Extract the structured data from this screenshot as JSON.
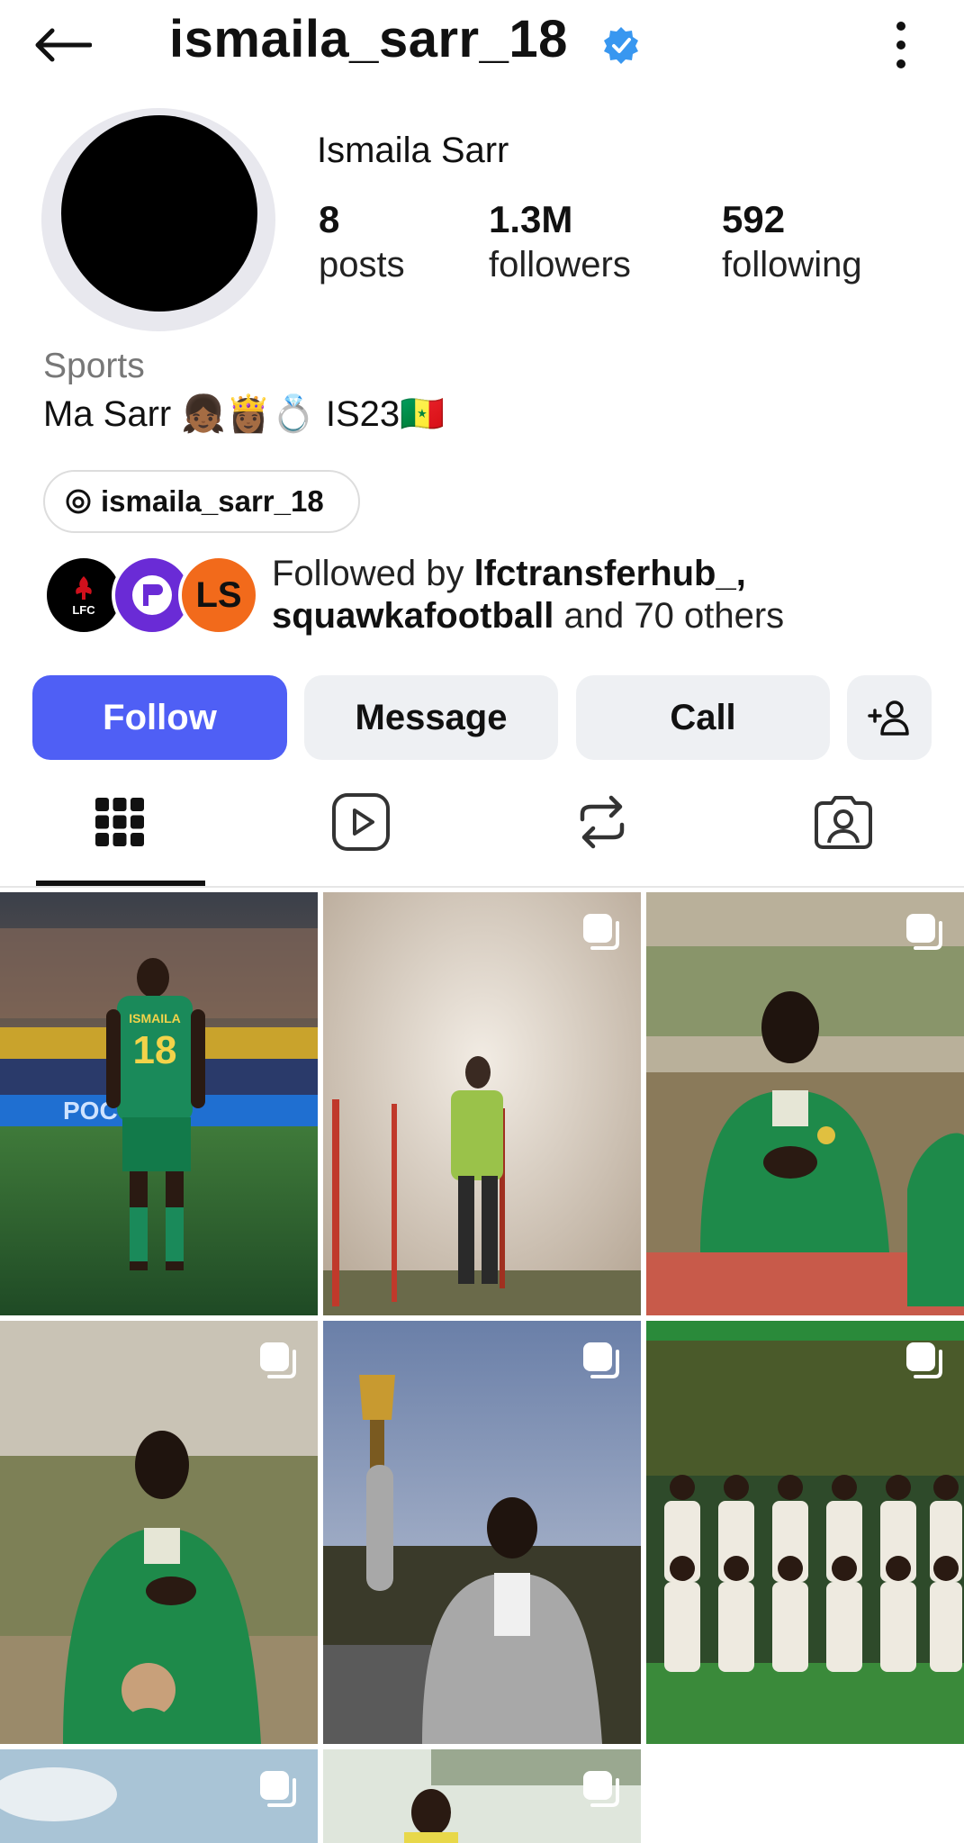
{
  "header": {
    "username": "ismaila_sarr_18",
    "back_icon": "arrow-left-icon",
    "verified_icon": "verified-badge-icon",
    "more_icon": "more-vertical-icon"
  },
  "profile": {
    "full_name": "Ismaila Sarr",
    "stats": {
      "posts_value": "8",
      "posts_label": "posts",
      "followers_value": "1.3M",
      "followers_label": "followers",
      "following_value": "592",
      "following_label": "following"
    },
    "category": "Sports",
    "bio": "Ma Sarr 👧🏾👸🏾💍 IS23🇸🇳",
    "threads_handle": "ismaila_sarr_18",
    "followed_by": {
      "prefix": "Followed by ",
      "names": "lfctransferhub_,",
      "line2_name": "squawkafootball",
      "suffix": " and 70 others",
      "avatar_1_text": "LFC",
      "avatar_3_text": "LS"
    }
  },
  "actions": {
    "follow": "Follow",
    "message": "Message",
    "call": "Call",
    "add_user_icon": "add-person-icon"
  },
  "tabs": [
    {
      "name": "posts-grid",
      "icon": "grid-icon",
      "selected": true
    },
    {
      "name": "reels",
      "icon": "reels-icon",
      "selected": false
    },
    {
      "name": "reposts",
      "icon": "repost-icon",
      "selected": false
    },
    {
      "name": "tagged",
      "icon": "tagged-person-icon",
      "selected": false
    }
  ],
  "grid": {
    "tiles": [
      {
        "subject": "player in green #18 jersey walking on pitch",
        "multi": false
      },
      {
        "subject": "player training under water sprinkler",
        "multi": true
      },
      {
        "subject": "player in green tracksuit, hand on chest",
        "multi": true
      },
      {
        "subject": "player in green tracksuit with child mascot",
        "multi": true
      },
      {
        "subject": "player holding trophy in crowd",
        "multi": true
      },
      {
        "subject": "team photo in white kits",
        "multi": true
      },
      {
        "subject": "sky",
        "multi": true
      },
      {
        "subject": "player portrait",
        "multi": true
      }
    ],
    "jersey_name": "ISMAILA",
    "jersey_number": "18"
  },
  "colors": {
    "follow_button": "#4f5ff5",
    "verified_badge": "#3897f0",
    "secondary_button": "#eef0f3"
  }
}
